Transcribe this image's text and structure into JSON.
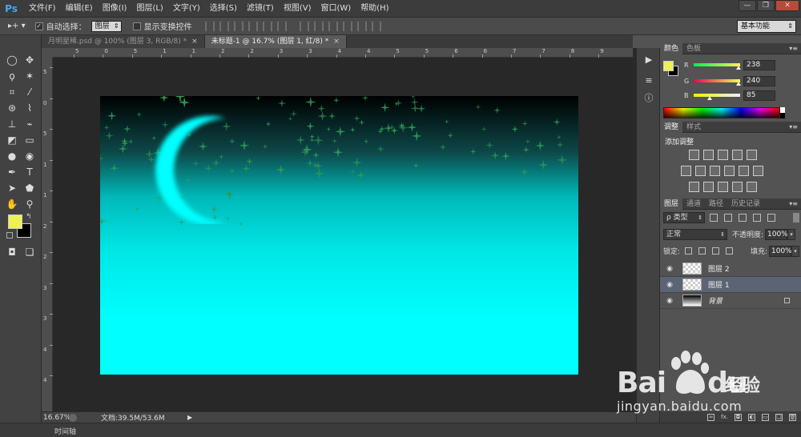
{
  "app": {
    "logo": "Ps"
  },
  "menu": [
    "文件(F)",
    "编辑(E)",
    "图像(I)",
    "图层(L)",
    "文字(Y)",
    "选择(S)",
    "滤镜(T)",
    "视图(V)",
    "窗口(W)",
    "帮助(H)"
  ],
  "window_controls": {
    "minimize": "—",
    "restore": "❐",
    "close": "✕"
  },
  "options": {
    "tool_arrow": "▸+ ▾",
    "auto_select_label": "自动选择：",
    "auto_select_value": "图层",
    "show_transform_label": "显示变换控件",
    "workspace": "基本功能"
  },
  "tabs": [
    {
      "label": "月明星稀.psd @ 100% (图层 3, RGB/8) *",
      "close": "×"
    },
    {
      "label": "未标题-1 @ 16.7% (图层 1, 红/8) *",
      "close": "×"
    }
  ],
  "ruler_h_labels": [
    "5",
    "0",
    "5",
    "1",
    "1",
    "2",
    "2",
    "3",
    "3",
    "4",
    "4",
    "5",
    "5",
    "6",
    "6",
    "7",
    "7",
    "8",
    "9"
  ],
  "ruler_v_labels": [
    "5",
    "0",
    "5",
    "1",
    "1",
    "2",
    "2",
    "3",
    "3",
    "4",
    "4"
  ],
  "status": {
    "zoom": "16.67%",
    "doc": "文档:39.5M/53.6M",
    "arrow": "▶"
  },
  "timeline": {
    "label": "时间轴"
  },
  "colors": {
    "foreground": "#eef055",
    "background": "#000000",
    "canvas_top": "#000000",
    "canvas_bottom": "#00ffff",
    "moon": "#00ffff",
    "stars": "#2e9a55"
  },
  "color_panel": {
    "tabs": [
      "颜色",
      "色板"
    ],
    "r_label": "R",
    "r_value": "238",
    "g_label": "G",
    "g_value": "240",
    "b_label": "B",
    "b_value": "85"
  },
  "adjust_panel": {
    "tabs": [
      "调整",
      "样式"
    ],
    "title": "添加调整"
  },
  "layers_panel": {
    "tabs": [
      "图层",
      "通道",
      "路径",
      "历史记录"
    ],
    "kind": "ρ 类型",
    "blend": "正常",
    "opacity_label": "不透明度:",
    "opacity_value": "100%",
    "lock_label": "锁定:",
    "fill_label": "填充:",
    "fill_value": "100%",
    "layers": [
      {
        "name": "图层 2"
      },
      {
        "name": "图层 1"
      },
      {
        "name": "背景"
      }
    ],
    "footer_fx": "fx."
  },
  "watermark": {
    "bai": "Bai",
    "du": "du",
    "cn": "经验",
    "url": "jingyan.baidu.com"
  }
}
